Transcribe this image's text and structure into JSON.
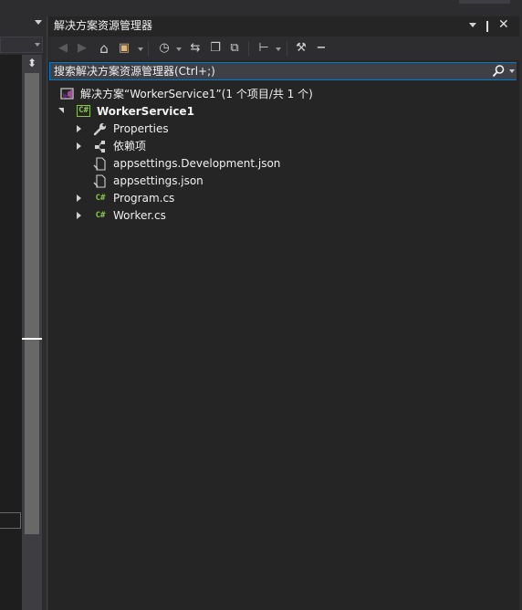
{
  "window": {
    "panel_title": "解决方案资源管理器",
    "pin_glyph": "❙",
    "close_glyph": "✕"
  },
  "colors": {
    "accent": "#007acc",
    "background": "#252526",
    "chrome": "#2d2d30",
    "csharp_icon": "#8bc34a",
    "solution_icon": "#68217a"
  },
  "toolbar": {
    "items": [
      {
        "name": "back-icon",
        "glyph": "◀",
        "enabled": false
      },
      {
        "name": "forward-icon",
        "glyph": "▶",
        "enabled": false
      },
      {
        "name": "home-icon",
        "glyph": "⌂",
        "enabled": true
      },
      {
        "name": "switch-views-icon",
        "glyph": "▣",
        "enabled": true
      },
      {
        "name": "pending-changes-filter-icon",
        "glyph": "◷",
        "enabled": true
      },
      {
        "name": "sync-icon",
        "glyph": "⇆",
        "enabled": true
      },
      {
        "name": "collapse-all-icon",
        "glyph": "❐",
        "enabled": true
      },
      {
        "name": "show-all-files-icon",
        "glyph": "⧉",
        "enabled": true
      },
      {
        "name": "view-class-diagram-icon",
        "glyph": "⊢",
        "enabled": true
      },
      {
        "name": "properties-wrench-icon",
        "glyph": "⚒",
        "enabled": true
      },
      {
        "name": "preview-icon",
        "glyph": "−",
        "enabled": true
      }
    ]
  },
  "search": {
    "placeholder": "搜索解决方案资源管理器(Ctrl+;)",
    "value": ""
  },
  "tree": {
    "solution": {
      "label": "解决方案“WorkerService1”(1 个项目/共 1 个)"
    },
    "project": {
      "label": "WorkerService1",
      "icon": "C#"
    },
    "items": [
      {
        "label": "Properties",
        "icon": "wrench-icon",
        "expandable": true
      },
      {
        "label": "依赖项",
        "icon": "dependencies-icon",
        "expandable": true
      },
      {
        "label": "appsettings.Development.json",
        "icon": "json-file-icon",
        "expandable": false
      },
      {
        "label": "appsettings.json",
        "icon": "json-file-icon",
        "expandable": false
      },
      {
        "label": "Program.cs",
        "icon": "csharp-file-icon",
        "expandable": true
      },
      {
        "label": "Worker.cs",
        "icon": "csharp-file-icon",
        "expandable": true
      }
    ],
    "csharp_badge": "C#"
  },
  "left": {
    "splitter_glyph": "⬍"
  }
}
